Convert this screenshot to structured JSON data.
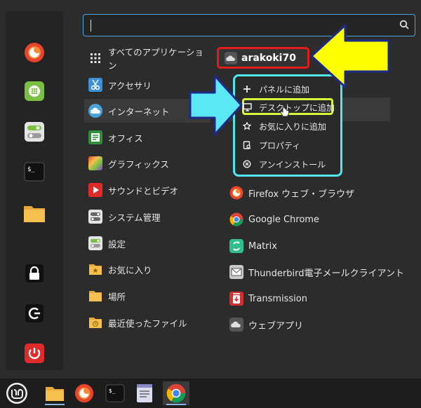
{
  "search": {
    "placeholder": "",
    "value": ""
  },
  "categories": [
    {
      "label": "すべてのアプリケーション",
      "icon": "grid-icon"
    },
    {
      "label": "アクセサリ",
      "icon": "scissors-icon"
    },
    {
      "label": "インターネット",
      "icon": "cloud-icon"
    },
    {
      "label": "オフィス",
      "icon": "office-icon"
    },
    {
      "label": "グラフィックス",
      "icon": "palette-icon"
    },
    {
      "label": "サウンドとビデオ",
      "icon": "play-icon"
    },
    {
      "label": "システム管理",
      "icon": "system-icon"
    },
    {
      "label": "設定",
      "icon": "toggle-icon"
    },
    {
      "label": "お気に入り",
      "icon": "star-folder-icon"
    },
    {
      "label": "場所",
      "icon": "folder-icon"
    },
    {
      "label": "最近使ったファイル",
      "icon": "recent-folder-icon"
    }
  ],
  "apps": [
    {
      "label": "arakoki70",
      "icon": "cloud-app-icon"
    },
    {
      "label": "Firefox ウェブ・ブラウザ",
      "icon": "firefox-icon"
    },
    {
      "label": "Google Chrome",
      "icon": "chrome-icon"
    },
    {
      "label": "Matrix",
      "icon": "matrix-icon"
    },
    {
      "label": "Thunderbird電子メールクライアント",
      "icon": "thunderbird-icon"
    },
    {
      "label": "Transmission",
      "icon": "transmission-icon"
    },
    {
      "label": "ウェブアプリ",
      "icon": "webapp-icon"
    }
  ],
  "context_menu": [
    {
      "label": "パネルに追加",
      "icon": "plus-icon"
    },
    {
      "label": "デスクトップに追加",
      "icon": "monitor-icon"
    },
    {
      "label": "お気に入りに追加",
      "icon": "star-icon"
    },
    {
      "label": "プロパティ",
      "icon": "properties-icon"
    },
    {
      "label": "アンインストール",
      "icon": "uninstall-icon"
    }
  ],
  "colors": {
    "accent": "#4aa3d8",
    "user_box": "#e21b1b",
    "ctx_border": "#4fe6ee",
    "ctx_highlight": "#d7f53b",
    "arrow_yellow": "#ffff00",
    "arrow_cyan": "#5ae8f5",
    "arrow_outline": "#1c2a8c"
  }
}
